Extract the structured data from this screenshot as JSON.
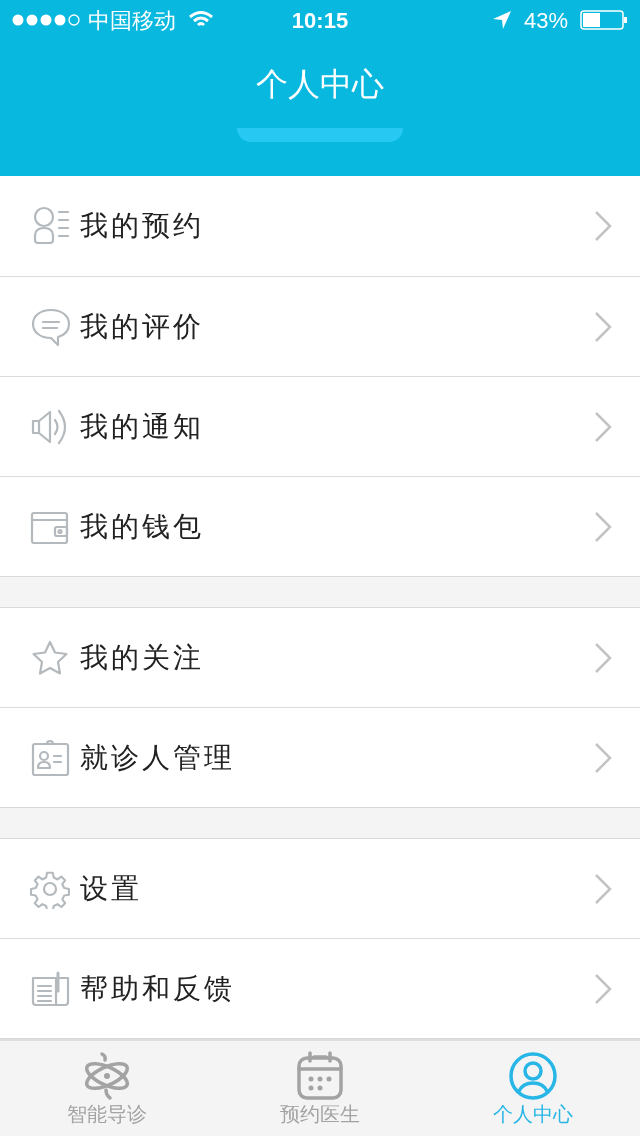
{
  "status_bar": {
    "carrier": "中国移动",
    "time": "10:15",
    "battery": "43%"
  },
  "header": {
    "title": "个人中心"
  },
  "groups": [
    {
      "items": [
        {
          "kind": "appointment",
          "label": "我的预约"
        },
        {
          "kind": "review",
          "label": "我的评价"
        },
        {
          "kind": "notice",
          "label": "我的通知"
        },
        {
          "kind": "wallet",
          "label": "我的钱包"
        }
      ]
    },
    {
      "items": [
        {
          "kind": "favorite",
          "label": "我的关注"
        },
        {
          "kind": "patients",
          "label": "就诊人管理"
        }
      ]
    },
    {
      "items": [
        {
          "kind": "settings",
          "label": "设置"
        },
        {
          "kind": "help",
          "label": "帮助和反馈"
        }
      ]
    }
  ],
  "tabs": [
    {
      "kind": "guide",
      "label": "智能导诊",
      "selected": false
    },
    {
      "kind": "doctor",
      "label": "预约医生",
      "selected": false
    },
    {
      "kind": "profile",
      "label": "个人中心",
      "selected": true
    }
  ]
}
